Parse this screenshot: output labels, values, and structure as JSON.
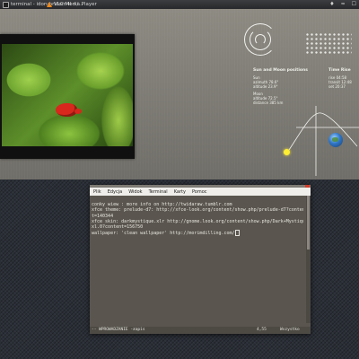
{
  "taskbar": {
    "tasks": [
      {
        "label": "terminal - idoruhridom-ll ~/..."
      },
      {
        "label": "VLC Media Player"
      }
    ],
    "tray": [
      "♦",
      "≈",
      "☐"
    ]
  },
  "widgets": {
    "sun_moon": {
      "heading": "Sun and Moon positions",
      "lines": [
        "Sun",
        "azimuth 78.6°",
        "altitude 23.9°",
        "Moon",
        "altitude 72.5°",
        "distance 385 km"
      ]
    },
    "time_rise": {
      "heading": "Time Rise",
      "lines": [
        "rise 04:58",
        "transit 12:48",
        "set 20:37"
      ]
    }
  },
  "terminal": {
    "menu": [
      "Plik",
      "Edycja",
      "Widok",
      "Terminal",
      "Karty",
      "Pomoc"
    ],
    "lines": [
      "conky wiew : more info on http://twidaraw.tumblr.com",
      "xfce theme: prelude-d7: http://xfce-look.org/content/show.php/prelude-d7?conten",
      "t=140344",
      "xfce skin: darkmystique.xlr http://gnome.look.org/content/show.php/Dark+Mystique+",
      "xl.0?content=156750",
      "wallpaper: 'clean wallpaper' http://morimdilling.com/"
    ],
    "status": {
      "mode": "-- WPROWADZANIE --",
      "file": "zapis",
      "position": "4,55",
      "scope": "Wszystko"
    }
  }
}
